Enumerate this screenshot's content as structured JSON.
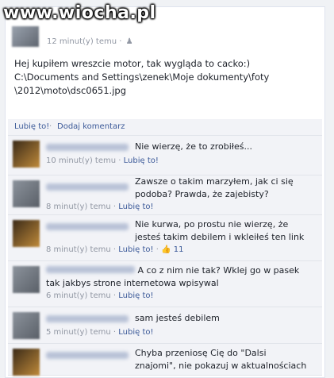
{
  "watermark": "www.wiocha.pl",
  "post": {
    "time": "12 minut(y) temu",
    "separator": "·",
    "lines": [
      "Hej kupiłem wreszcie motor, tak wygląda to cacko:)",
      "C:\\Documents and Settings\\zenek\\Moje dokumenty\\foty",
      "\\2012\\moto\\dsc0651.jpg"
    ]
  },
  "actions": {
    "like": "Lubię to!",
    "dot": "·",
    "comment": "Dodaj komentarz"
  },
  "comments": [
    {
      "text": "Nie wierzę, że to zrobiłeś...",
      "time": "10 minut(y) temu",
      "like": "Lubię to!",
      "likes": ""
    },
    {
      "text": "Zawsze o takim marzyłem, jak ci się podoba? Prawda, że zajebisty?",
      "time": "8 minut(y) temu",
      "like": "Lubię to!",
      "likes": ""
    },
    {
      "text": "Nie kurwa, po prostu nie wierzę, że jesteś takim debilem i wkleiłeś ten link",
      "time": "8 minut(y) temu",
      "like": "Lubię to!",
      "likes": "11"
    },
    {
      "text": "A co z nim nie tak? Wklej go w pasek tak jakbys strone internetowa wpisywal",
      "time": "6 minut(y) temu",
      "like": "Lubię to!",
      "likes": ""
    },
    {
      "text": "sam jesteś debilem",
      "time": "5 minut(y) temu",
      "like": "Lubię to!",
      "likes": ""
    },
    {
      "text": "Chyba przeniosę Cię do \"Dalsi znajomi\", nie pokazuj w aktualnościach",
      "time": "",
      "like": "",
      "likes": ""
    }
  ],
  "colors": {
    "link": "#3b5998",
    "meta": "#9197a3",
    "comment_bg": "#f2f3f7"
  },
  "icons": {
    "friends": "friends-icon",
    "like": "thumbs-up-icon"
  }
}
